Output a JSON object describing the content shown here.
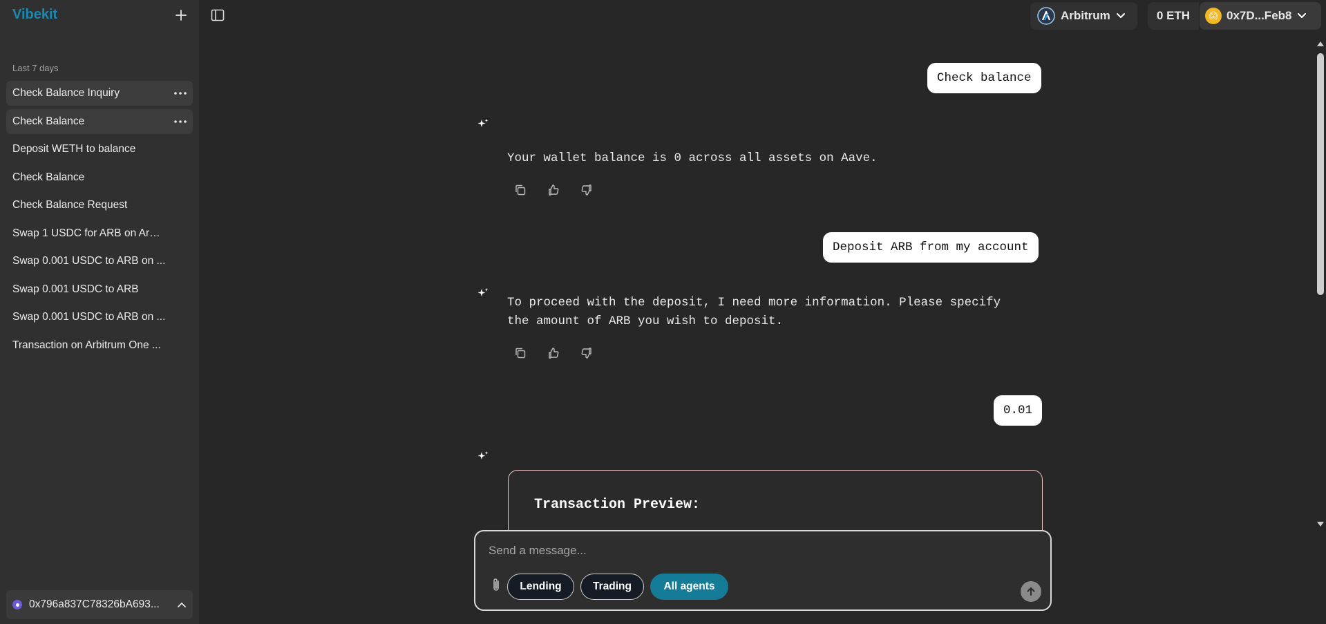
{
  "sidebar": {
    "brand": "Vibekit",
    "section_label": "Last 7 days",
    "chats": [
      {
        "label": "Check Balance Inquiry",
        "active": true
      },
      {
        "label": "Check Balance",
        "active": true
      },
      {
        "label": "Deposit WETH to balance",
        "active": false
      },
      {
        "label": "Check Balance",
        "active": false
      },
      {
        "label": "Check Balance Request",
        "active": false
      },
      {
        "label": "Swap 1 USDC for ARB on Arbi...",
        "active": false
      },
      {
        "label": "Swap 0.001 USDC to ARB on ...",
        "active": false
      },
      {
        "label": "Swap 0.001 USDC to ARB",
        "active": false
      },
      {
        "label": "Swap 0.001 USDC to ARB on ...",
        "active": false
      },
      {
        "label": "Transaction on Arbitrum One ...",
        "active": false
      }
    ],
    "account_address": "0x796a837C78326bA693..."
  },
  "topbar": {
    "chain": "Arbitrum",
    "eth_balance": "0 ETH",
    "wallet": "0x7D...Feb8"
  },
  "messages": {
    "user_1": "Check balance",
    "assistant_1": "Your wallet balance is 0 across all assets on Aave.",
    "user_2": "Deposit ARB from my account",
    "assistant_2_line1": "To proceed with the deposit, I need more information. Please specify",
    "assistant_2_line2": "the amount of ARB you wish to deposit.",
    "user_3": "0.01",
    "tx_preview_title": "Transaction Preview:"
  },
  "composer": {
    "placeholder": "Send a message...",
    "pills": [
      "Lending",
      "Trading",
      "All agents"
    ],
    "active_pill": "All agents"
  },
  "colors": {
    "brand": "#1b88b0",
    "active_pill": "#147c96",
    "card_border": "#f0c7c7"
  }
}
